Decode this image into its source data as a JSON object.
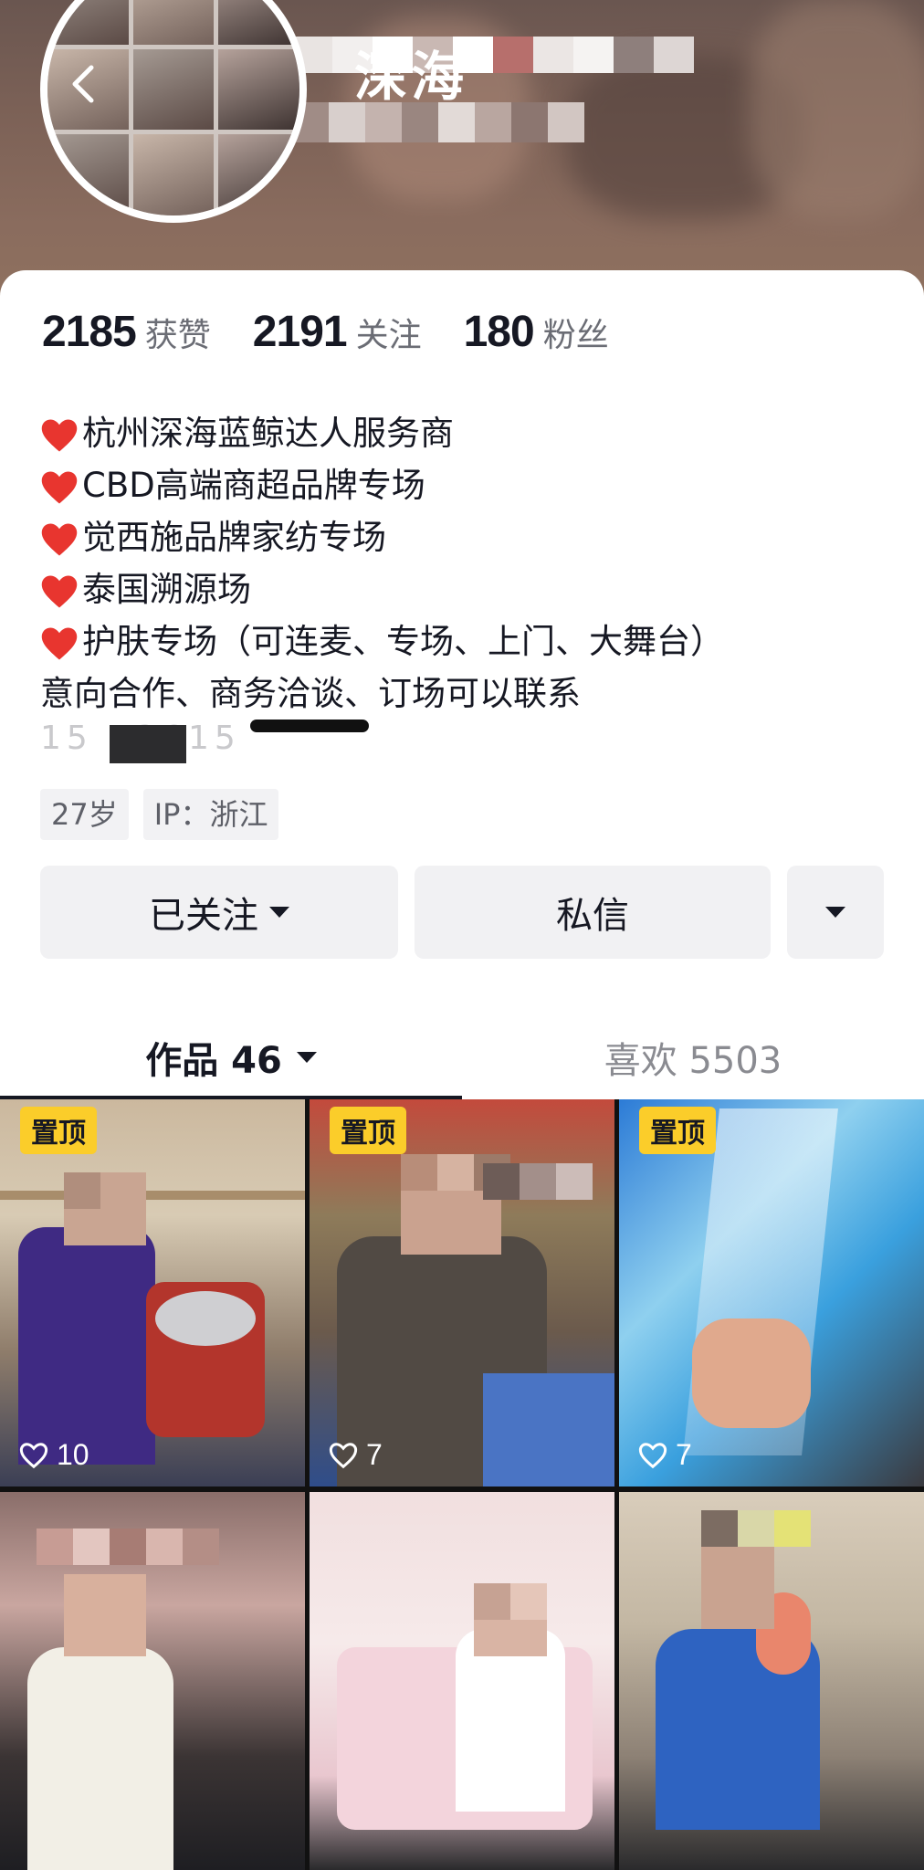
{
  "header": {
    "name_visible": "深海",
    "back_icon": "back-arrow-icon"
  },
  "stats": [
    {
      "value": "2185",
      "label": "获赞"
    },
    {
      "value": "2191",
      "label": "关注"
    },
    {
      "value": "180",
      "label": "粉丝"
    }
  ],
  "bio": {
    "lines": [
      "杭州深海蓝鲸达人服务商",
      "CBD高端商超品牌专场",
      "觉西施品牌家纺专场",
      "泰国溯源场",
      "护肤专场（可连麦、专场、上门、大舞台）"
    ],
    "contact_line": "意向合作、商务洽谈、订场可以联系",
    "phone_partial": "15  73615",
    "heart_color": "#e8352f"
  },
  "tags": [
    "27岁",
    "IP：浙江"
  ],
  "actions": {
    "follow_label": "已关注",
    "message_label": "私信"
  },
  "tabs": {
    "works_label": "作品 46",
    "likes_label": "喜欢 5503"
  },
  "videos": [
    {
      "pinned": true,
      "pin_label": "置顶",
      "likes": "10"
    },
    {
      "pinned": true,
      "pin_label": "置顶",
      "likes": "7"
    },
    {
      "pinned": true,
      "pin_label": "置顶",
      "likes": "7"
    },
    {
      "pinned": false,
      "pin_label": "",
      "likes": ""
    },
    {
      "pinned": false,
      "pin_label": "",
      "likes": ""
    },
    {
      "pinned": false,
      "pin_label": "",
      "likes": ""
    }
  ],
  "colors": {
    "pin_bg": "#fbcd2a",
    "text_primary": "#161823",
    "text_secondary": "#6b6d75",
    "button_bg": "#f1f1f3"
  }
}
